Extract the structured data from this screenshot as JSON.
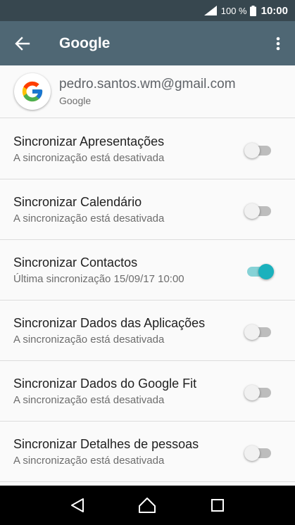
{
  "status_bar": {
    "battery_percent": "100 %",
    "time": "10:00"
  },
  "app_bar": {
    "title": "Google",
    "back_icon": "arrow-left-icon",
    "more_icon": "more-vert-icon"
  },
  "account": {
    "email": "pedro.santos.wm@gmail.com",
    "provider": "Google",
    "avatar_icon": "google-g-icon"
  },
  "sync_items": [
    {
      "label": "Sincronizar Apresentações",
      "summary": "A sincronização está desativada",
      "enabled": false
    },
    {
      "label": "Sincronizar Calendário",
      "summary": "A sincronização está desativada",
      "enabled": false
    },
    {
      "label": "Sincronizar Contactos",
      "summary": "Última sincronização 15/09/17 10:00",
      "enabled": true
    },
    {
      "label": "Sincronizar Dados das Aplicações",
      "summary": "A sincronização está desativada",
      "enabled": false
    },
    {
      "label": "Sincronizar Dados do Google Fit",
      "summary": "A sincronização está desativada",
      "enabled": false
    },
    {
      "label": "Sincronizar Detalhes de pessoas",
      "summary": "A sincronização está desativada",
      "enabled": false
    }
  ],
  "nav_bar": {
    "back_icon": "triangle-back-icon",
    "home_icon": "circle-home-icon",
    "recents_icon": "square-recents-icon"
  },
  "colors": {
    "status_bar": "#37474f",
    "app_bar": "#4f6774",
    "switch_on_thumb": "#1ab1bd",
    "switch_on_track": "#86d2d6",
    "switch_off_track": "#bdbdbd"
  }
}
